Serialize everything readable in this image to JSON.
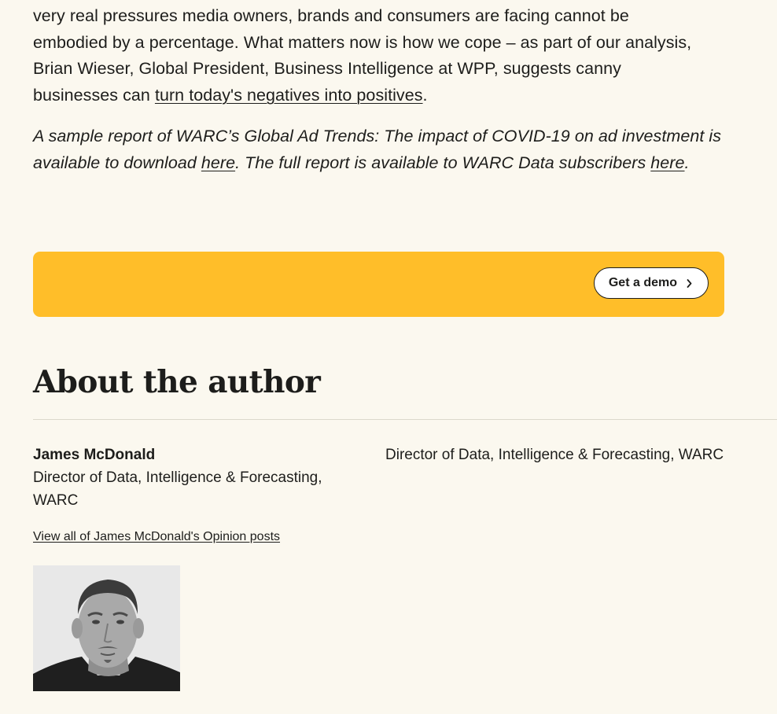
{
  "article": {
    "paragraph1_lines": [
      "very real pressures media owners, brands and consumers are facing cannot be",
      "embodied by a percentage. What matters now is how we cope – as part of our analysis,",
      "Brian Wieser, Global President, Business Intelligence at WPP, suggests canny",
      "businesses can "
    ],
    "paragraph1_link": "turn today's negatives into positives",
    "paragraph1_end": ".",
    "paragraph2_start": "A sample report of WARC’s Global Ad Trends: The impact of COVID-19 on ad investment is available to download ",
    "paragraph2_link1": "here",
    "paragraph2_middle": ". The full report is available to WARC Data subscribers ",
    "paragraph2_link2": "here",
    "paragraph2_end": "."
  },
  "cta": {
    "button_label": "Get a demo",
    "button_icon": "chevron-right-icon",
    "banner_color": "#ffbe29"
  },
  "author_section": {
    "title": "About the author",
    "name": "James McDonald",
    "role": "Director of Data, Intelligence & Forecasting, WARC",
    "role_right": "Director of Data, Intelligence & Forecasting, WARC",
    "posts_link": "View all of James McDonald's Opinion posts"
  }
}
